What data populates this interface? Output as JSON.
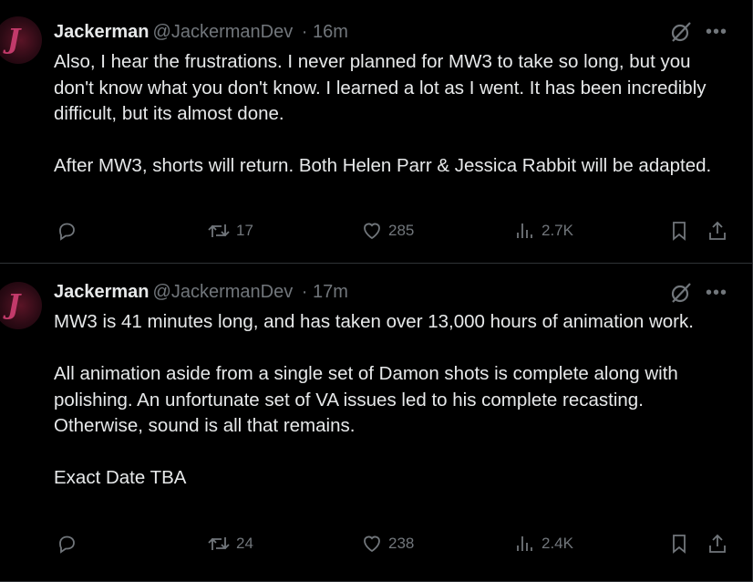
{
  "tweets": [
    {
      "author": "Jackerman",
      "handle": "@JackermanDev",
      "time": "· 16m",
      "paragraphs": [
        "Also, I hear the frustrations. I never planned for MW3 to take so long, but you don't know what you don't know. I learned a lot as I went. It has been incredibly difficult, but its almost done.",
        "After MW3, shorts will return. Both Helen Parr & Jessica Rabbit will be adapted."
      ],
      "retweets": "17",
      "likes": "285",
      "views": "2.7K"
    },
    {
      "author": "Jackerman",
      "handle": "@JackermanDev",
      "time": "· 17m",
      "paragraphs": [
        "MW3 is 41 minutes long, and has taken over 13,000 hours of animation work.",
        "All animation aside from a single set of Damon shots is complete along with polishing. An unfortunate set of VA issues led to his complete recasting. Otherwise, sound is all that remains.",
        "Exact Date TBA"
      ],
      "retweets": "24",
      "likes": "238",
      "views": "2.4K"
    }
  ],
  "icons": {
    "reply": "reply-icon",
    "retweet": "retweet-icon",
    "like": "heart-icon",
    "views": "analytics-icon",
    "bookmark": "bookmark-icon",
    "share": "share-icon",
    "grok": "grok-icon",
    "more": "more-icon"
  },
  "colors": {
    "background": "#000000",
    "text": "#e7e9ea",
    "muted": "#71767b",
    "divider": "#2f3336"
  }
}
